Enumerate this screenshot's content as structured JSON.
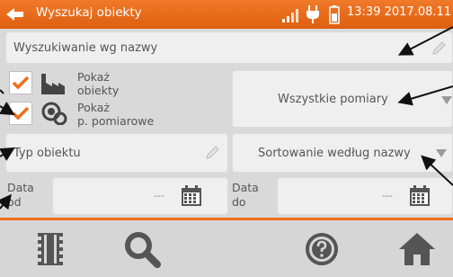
{
  "header": {
    "title": "Wyszukaj obiekty",
    "clock": "13:39 2017.08.11"
  },
  "search": {
    "label": "Wyszukiwanie wg nazwy"
  },
  "checks": [
    {
      "label_line1": "Pokaż",
      "label_line2": "obiekty",
      "checked": true
    },
    {
      "label_line1": "Pokaż",
      "label_line2": "p. pomiarowe",
      "checked": true
    }
  ],
  "measurement_select": {
    "value": "Wszystkie pomiary"
  },
  "object_type": {
    "label": "Typ obiektu"
  },
  "sort_select": {
    "value": "Sortowanie według nazwy"
  },
  "date_from": {
    "label_line1": "Data",
    "label_line2": "od",
    "value": "---"
  },
  "date_to": {
    "label_line1": "Data",
    "label_line2": "do",
    "value": "---"
  },
  "footer": {
    "buttons": [
      "memory-icon",
      "search-icon",
      "help-icon",
      "home-icon"
    ]
  },
  "colors": {
    "accent": "#ee6f1c",
    "background": "#d9d9d9",
    "panel": "#efefef"
  }
}
